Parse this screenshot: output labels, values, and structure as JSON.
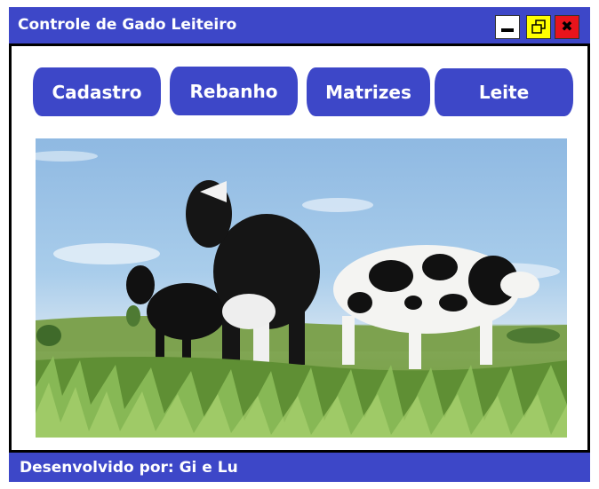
{
  "window": {
    "title": "Controle de Gado Leiteiro",
    "controls": {
      "minimize_icon": "minimize-icon",
      "restore_icon": "restore-icon",
      "close_glyph": "✖"
    }
  },
  "nav": {
    "buttons": [
      {
        "label": "Cadastro"
      },
      {
        "label": "Rebanho"
      },
      {
        "label": "Matrizes"
      },
      {
        "label": "Leite"
      }
    ]
  },
  "footer": {
    "text": "Desenvolvido por: Gi e Lu"
  },
  "colors": {
    "accent": "#3d47c8",
    "minimize_bg": "#ffffff",
    "maximize_bg": "#ffff00",
    "close_bg": "#e8141c"
  }
}
